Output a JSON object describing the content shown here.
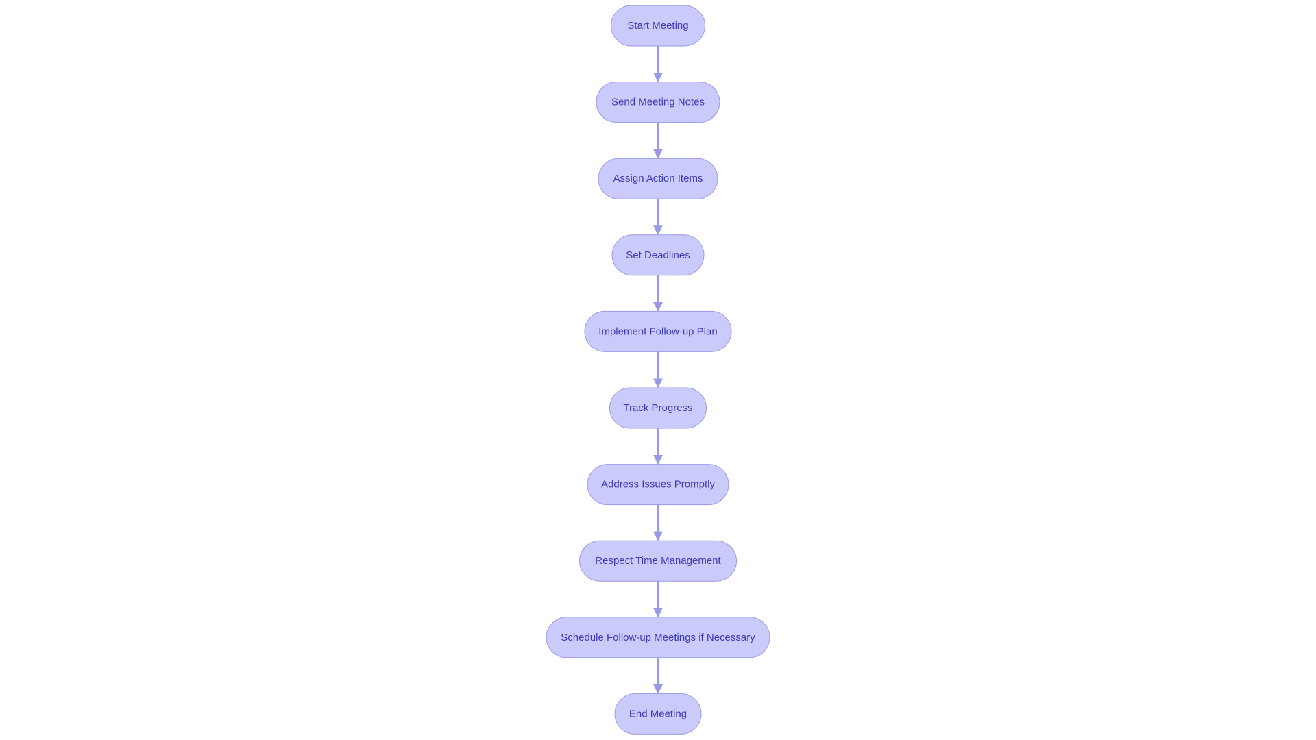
{
  "diagram": {
    "type": "flowchart",
    "direction": "top-to-bottom",
    "colors": {
      "node_fill": "#cbcbfb",
      "node_stroke": "#9a9ae6",
      "edge": "#9999e6",
      "text": "#3b3bb3"
    },
    "nodes": [
      {
        "id": "start",
        "label": "Start Meeting",
        "shape": "stadium"
      },
      {
        "id": "notes",
        "label": "Send Meeting Notes",
        "shape": "stadium"
      },
      {
        "id": "assign",
        "label": "Assign Action Items",
        "shape": "stadium"
      },
      {
        "id": "deadlines",
        "label": "Set Deadlines",
        "shape": "stadium"
      },
      {
        "id": "implement",
        "label": "Implement Follow-up Plan",
        "shape": "stadium"
      },
      {
        "id": "track",
        "label": "Track Progress",
        "shape": "stadium"
      },
      {
        "id": "address",
        "label": "Address Issues Promptly",
        "shape": "stadium"
      },
      {
        "id": "respect",
        "label": "Respect Time Management",
        "shape": "stadium"
      },
      {
        "id": "schedule",
        "label": "Schedule Follow-up Meetings if Necessary",
        "shape": "stadium"
      },
      {
        "id": "end",
        "label": "End Meeting",
        "shape": "stadium"
      }
    ],
    "edges": [
      {
        "from": "start",
        "to": "notes"
      },
      {
        "from": "notes",
        "to": "assign"
      },
      {
        "from": "assign",
        "to": "deadlines"
      },
      {
        "from": "deadlines",
        "to": "implement"
      },
      {
        "from": "implement",
        "to": "track"
      },
      {
        "from": "track",
        "to": "address"
      },
      {
        "from": "address",
        "to": "respect"
      },
      {
        "from": "respect",
        "to": "schedule"
      },
      {
        "from": "schedule",
        "to": "end"
      }
    ]
  }
}
